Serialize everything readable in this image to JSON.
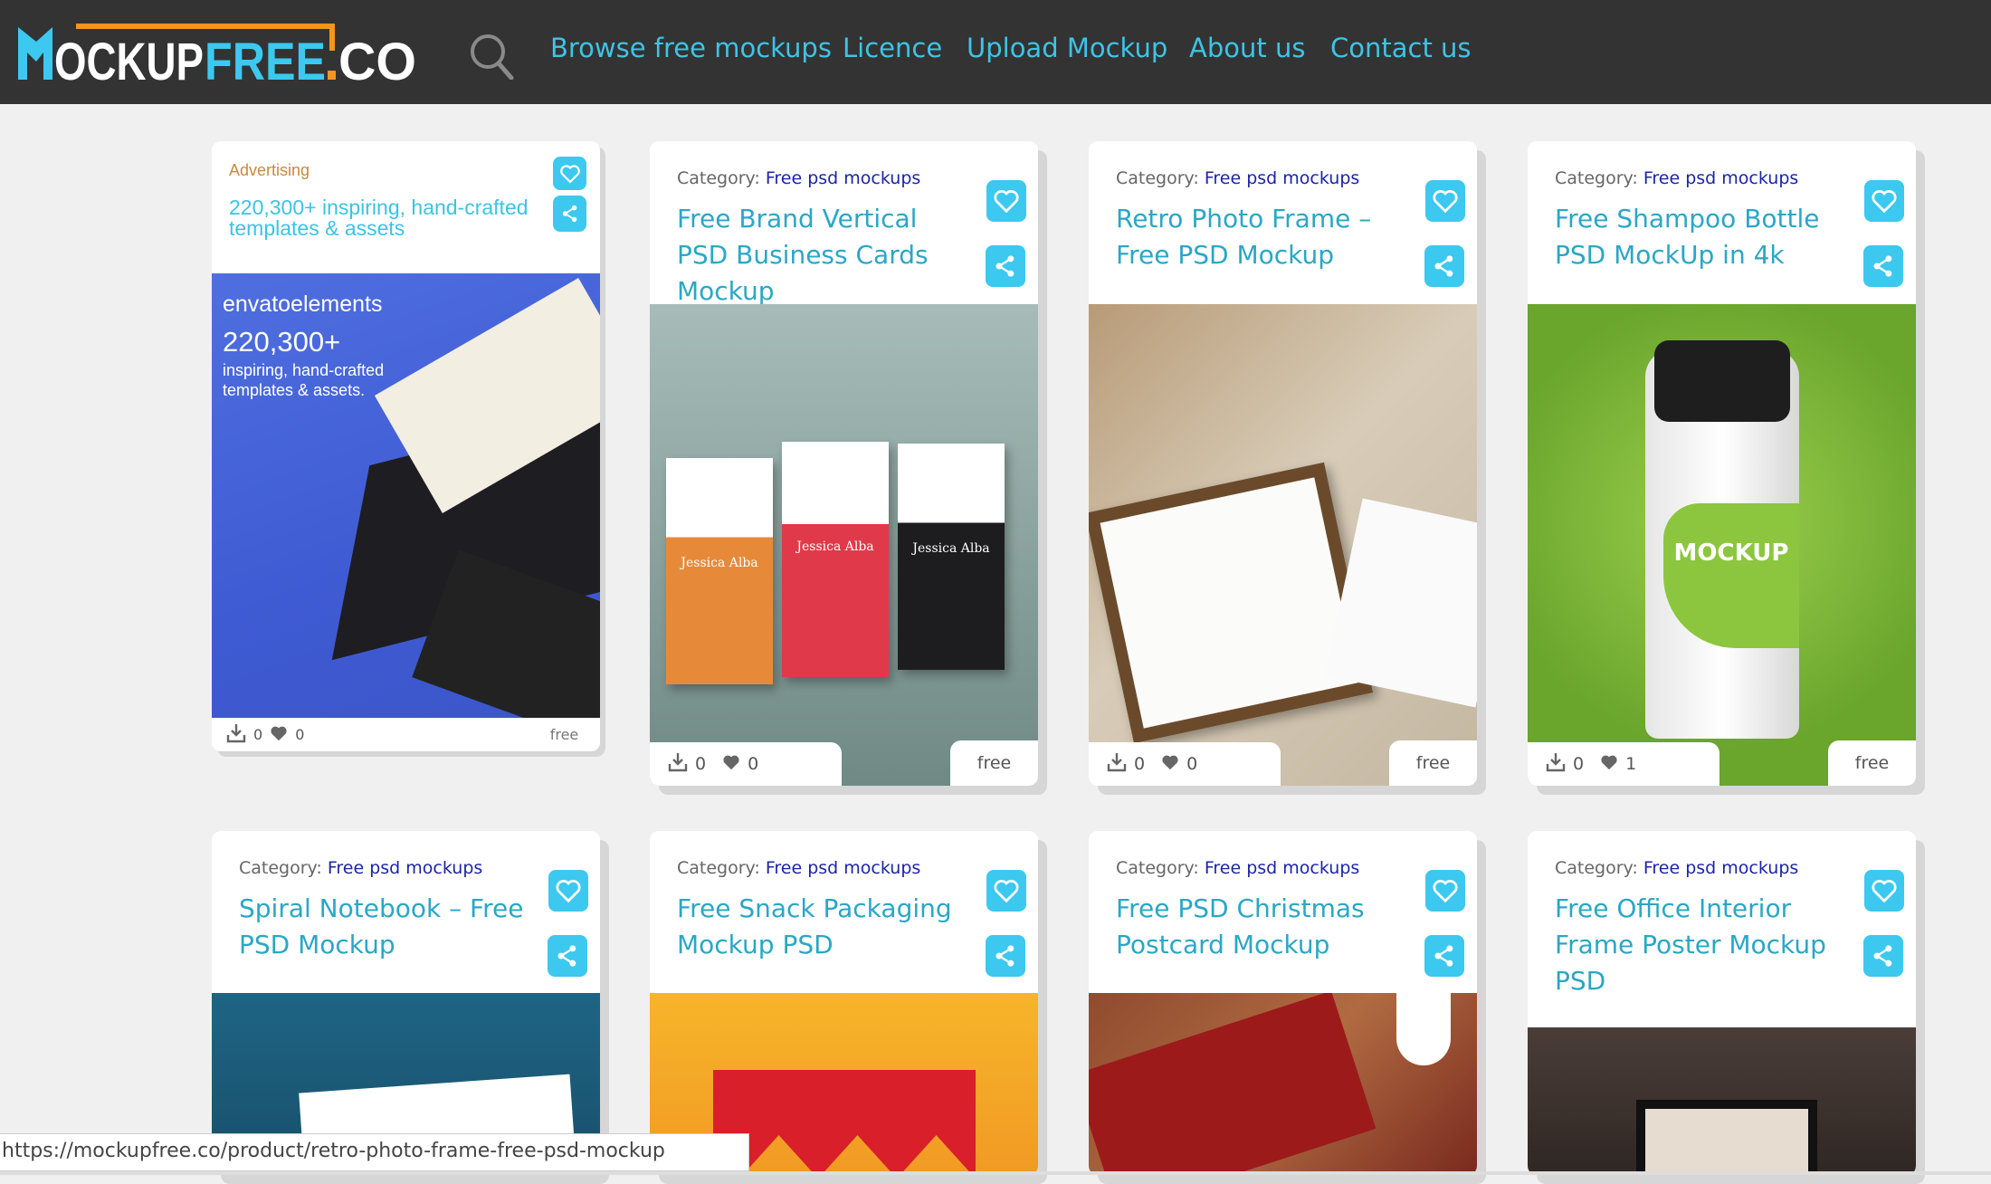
{
  "header": {
    "logo_text": "MOCKUPFREE.CO",
    "nav": [
      {
        "label": "Browse free mockups"
      },
      {
        "label": "Licence"
      },
      {
        "label": "Upload Mockup"
      },
      {
        "label": "About us"
      },
      {
        "label": "Contact us"
      }
    ]
  },
  "colors": {
    "accent": "#3cc8ef",
    "header_bg": "#333333",
    "title": "#2aa7c6",
    "category_link": "#1c24a8",
    "advertising": "#c98a3a"
  },
  "ad": {
    "label": "Advertising",
    "text": "220,300+ inspiring, hand-crafted templates & assets",
    "brand": "envatoelements",
    "headline": "220,300+",
    "sub": "inspiring, hand-crafted templates & assets.",
    "downloads": "0",
    "likes": "0",
    "price": "free"
  },
  "cards": [
    {
      "category_label": "Category:",
      "category": "Free psd mockups",
      "title": "Free Brand Vertical PSD Business Cards Mockup",
      "downloads": "0",
      "likes": "0",
      "price": "free",
      "image_caption": "Jessica Alba"
    },
    {
      "category_label": "Category:",
      "category": "Free psd mockups",
      "title": "Retro Photo Frame – Free PSD Mockup",
      "downloads": "0",
      "likes": "0",
      "price": "free"
    },
    {
      "category_label": "Category:",
      "category": "Free psd mockups",
      "title": "Free Shampoo Bottle PSD MockUp in 4k",
      "downloads": "0",
      "likes": "1",
      "price": "free",
      "image_caption": "MOCKUP"
    },
    {
      "category_label": "Category:",
      "category": "Free psd mockups",
      "title": "Spiral Notebook – Free PSD Mockup"
    },
    {
      "category_label": "Category:",
      "category": "Free psd mockups",
      "title": "Free Snack Packaging Mockup PSD"
    },
    {
      "category_label": "Category:",
      "category": "Free psd mockups",
      "title": "Free PSD Christmas Postcard Mockup"
    },
    {
      "category_label": "Category:",
      "category": "Free psd mockups",
      "title": "Free Office Interior Frame Poster Mockup PSD"
    }
  ],
  "status_url": "https://mockupfree.co/product/retro-photo-frame-free-psd-mockup"
}
